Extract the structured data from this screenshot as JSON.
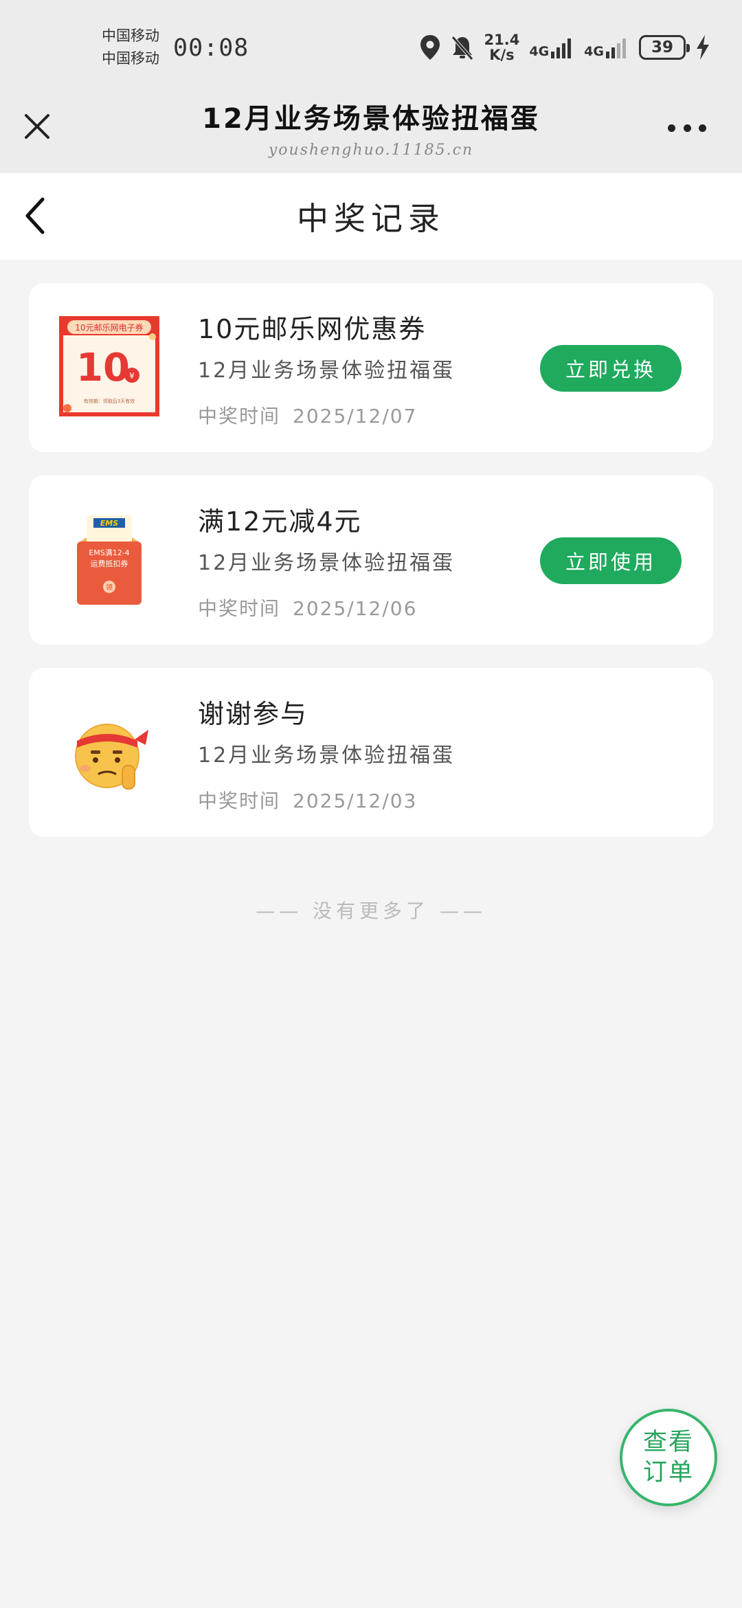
{
  "status_bar": {
    "carrier_1": "中国移动",
    "carrier_2": "中国移动",
    "time": "00:08",
    "speed_value": "21.4",
    "speed_unit": "K/s",
    "net_1": "4G",
    "net_2": "4G",
    "battery": "39"
  },
  "mp_header": {
    "title": "12月业务场景体验扭福蛋",
    "url": "youshenghuo.11185.cn"
  },
  "page": {
    "title": "中奖记录",
    "end_text": "—— 没有更多了 ——"
  },
  "records": [
    {
      "title": "10元邮乐网优惠券",
      "subtitle": "12月业务场景体验扭福蛋",
      "time_label": "中奖时间",
      "time": "2025/12/07",
      "button": "立即兑换",
      "thumb": {
        "banner": "10元邮乐网电子券",
        "value": "10",
        "unit": "¥",
        "note": "有效期：领取后3天有效"
      }
    },
    {
      "title": "满12元减4元",
      "subtitle": "12月业务场景体验扭福蛋",
      "time_label": "中奖时间",
      "time": "2025/12/06",
      "button": "立即使用",
      "thumb": {
        "brand": "EMS",
        "line_1": "EMS满12-4",
        "line_2": "运费抵扣券",
        "seal": "领"
      }
    },
    {
      "title": "谢谢参与",
      "subtitle": "12月业务场景体验扭福蛋",
      "time_label": "中奖时间",
      "time": "2025/12/03",
      "thumb": {
        "icon": "thinking-face-emoji-icon"
      }
    }
  ],
  "fab": {
    "line_1": "查看",
    "line_2": "订单"
  },
  "colors": {
    "accent_green": "#1faa5e",
    "coupon_red": "#e8392c",
    "envelope_red": "#ea5a3c"
  }
}
